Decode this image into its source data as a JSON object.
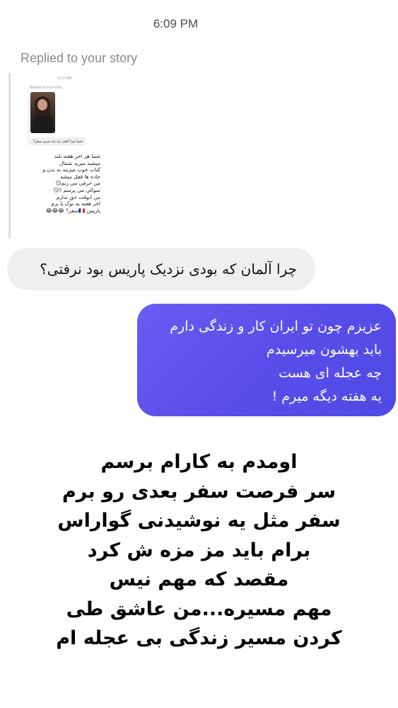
{
  "header": {
    "time": "6:09 PM"
  },
  "reply": {
    "label": "Replied to your story"
  },
  "story_preview": {
    "time": "11:57 AM",
    "replied_label": "Replied to your story",
    "reply_text": "حتما چرا انقدر تند تند میری سفر؟",
    "lines": [
      "شما هر اخر هفته بلند",
      "میشید میرید شمال",
      "کباب خوب میزنید به بدن و",
      "جاده ها قفل میشه",
      "من حرفی می زنم😏",
      "سوالی می پرسم ?😏",
      "من انوقت حق ندارم",
      "اخر هفته یه توک پا برم",
      "پاریس 🇫🇷سفر؟ 😂😂😂"
    ]
  },
  "incoming_message": {
    "text": "چرا آلمان که بودی نزدیک پاریس بود نرفتی؟"
  },
  "outgoing_message": {
    "lines": [
      "عزیزم چون تو ایران کار و زندگی دارم",
      "باید بهشون میرسیدم",
      "چه عجله ای هست",
      "یه هفته دیگه میرم !"
    ]
  },
  "caption": {
    "lines": [
      "اومدم به کارام برسم",
      "سر فرصت سفر بعدی رو برم",
      "سفر مثل یه نوشیدنی گواراس",
      "برام باید مز مزه ش کرد",
      "مقصد که مهم نیس",
      "مهم مسیره...من عاشق طی",
      "کردن مسیر زندگی بی عجله ام"
    ]
  }
}
